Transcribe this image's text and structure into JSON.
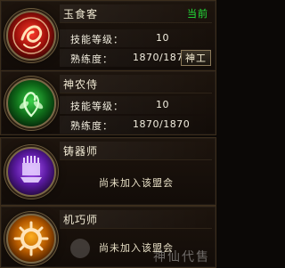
{
  "cards": [
    {
      "title": "玉食客",
      "status": "当前",
      "skill_level_label": "技能等级：",
      "skill_level_value": "10",
      "proficiency_label": "熟练度：",
      "proficiency_value": "1870/1870",
      "button": "神工",
      "emblem_icon": "red-dragon-emblem-icon"
    },
    {
      "title": "神农侍",
      "skill_level_label": "技能等级：",
      "skill_level_value": "10",
      "proficiency_label": "熟练度：",
      "proficiency_value": "1870/1870",
      "emblem_icon": "green-herb-emblem-icon"
    },
    {
      "title": "铸器师",
      "status_text": "尚未加入该盟会",
      "emblem_icon": "purple-forge-emblem-icon"
    },
    {
      "title": "机巧师",
      "status_text": "尚未加入该盟会",
      "emblem_icon": "orange-gear-emblem-icon"
    }
  ],
  "watermark": "神仙代售",
  "colors": {
    "current_status": "#23e23a",
    "text": "#f3efe0",
    "background": "#0b0806",
    "border": "#3b2d1c"
  }
}
